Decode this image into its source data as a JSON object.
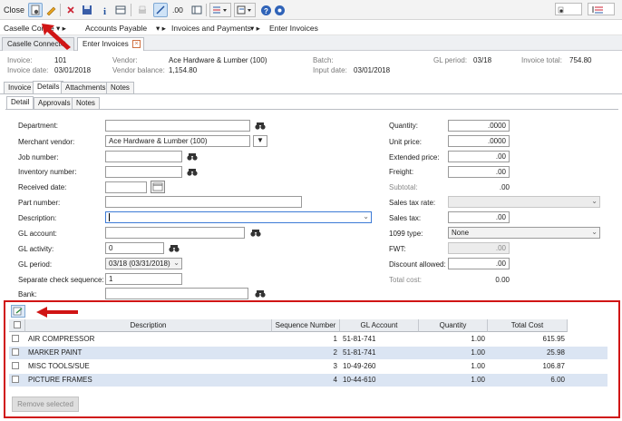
{
  "toolbar": {
    "close_label": "Close",
    "decimal_label": ".00"
  },
  "breadcrumb": {
    "home": "Caselle Conne",
    "module": "Accounts Payable",
    "section": "Invoices and Payments",
    "page": "Enter Invoices"
  },
  "tabs": [
    {
      "label": "Caselle Connect®"
    },
    {
      "label": "Enter Invoices"
    }
  ],
  "summary": {
    "invoice_label": "Invoice:",
    "invoice": "101",
    "invoice_date_label": "Invoice date:",
    "invoice_date": "03/01/2018",
    "vendor_label": "Vendor:",
    "vendor": "Ace Hardware & Lumber (100)",
    "vendor_balance_label": "Vendor balance:",
    "vendor_balance": "1,154.80",
    "batch_label": "Batch:",
    "input_date_label": "Input date:",
    "input_date": "03/01/2018",
    "gl_period_label": "GL period:",
    "gl_period": "03/18",
    "invoice_total_label": "Invoice total:",
    "invoice_total": "754.80"
  },
  "section_tabs": [
    "Invoice",
    "Details",
    "Attachments",
    "Notes"
  ],
  "detail_tabs": [
    "Detail",
    "Approvals",
    "Notes"
  ],
  "form": {
    "department_label": "Department:",
    "merchant_vendor_label": "Merchant vendor:",
    "merchant_vendor": "Ace Hardware & Lumber (100)",
    "job_number_label": "Job number:",
    "inventory_number_label": "Inventory number:",
    "received_date_label": "Received date:",
    "part_number_label": "Part number:",
    "description_label": "Description:",
    "gl_account_label": "GL account:",
    "gl_activity_label": "GL activity:",
    "gl_activity": "0",
    "gl_period_label": "GL period:",
    "gl_period": "03/18 (03/31/2018)",
    "separate_check_label": "Separate check sequence:",
    "separate_check": "1",
    "bank_label": "Bank:",
    "quantity_label": "Quantity:",
    "quantity": ".0000",
    "unit_price_label": "Unit price:",
    "unit_price": ".0000",
    "extended_price_label": "Extended price:",
    "extended_price": ".00",
    "freight_label": "Freight:",
    "freight": ".00",
    "subtotal_label": "Subtotal:",
    "subtotal": ".00",
    "sales_tax_rate_label": "Sales tax rate:",
    "sales_tax_label": "Sales tax:",
    "sales_tax": ".00",
    "type_1099_label": "1099 type:",
    "type_1099": "None",
    "fwt_label": "FWT:",
    "fwt": ".00",
    "discount_label": "Discount allowed:",
    "discount": ".00",
    "total_cost_label": "Total cost:",
    "total_cost": "0.00"
  },
  "grid": {
    "columns": [
      "Description",
      "Sequence Number",
      "GL Account",
      "Quantity",
      "Total Cost"
    ],
    "rows": [
      {
        "description": "AIR COMPRESSOR",
        "sequence": "1",
        "gl_account": "51-81-741",
        "quantity": "1.00",
        "total_cost": "615.95"
      },
      {
        "description": "MARKER PAINT",
        "sequence": "2",
        "gl_account": "51-81-741",
        "quantity": "1.00",
        "total_cost": "25.98"
      },
      {
        "description": "MISC TOOLS/SUE",
        "sequence": "3",
        "gl_account": "10-49-260",
        "quantity": "1.00",
        "total_cost": "106.87"
      },
      {
        "description": "PICTURE FRAMES",
        "sequence": "4",
        "gl_account": "10-44-610",
        "quantity": "1.00",
        "total_cost": "6.00"
      }
    ],
    "remove_label": "Remove selected"
  },
  "colors": {
    "highlight": "#d01515",
    "row_alt": "#dbe5f3",
    "selected_tool": "#cfe3f7"
  },
  "icons": [
    "new-icon",
    "edit-pencil-icon",
    "delete-icon",
    "save-icon",
    "info-icon",
    "print-icon",
    "calculator-icon",
    "list-icon",
    "help-icon",
    "settings-icon",
    "binoculars-icon",
    "calendar-icon",
    "add-detail-icon",
    "red-arrow-annotation"
  ]
}
